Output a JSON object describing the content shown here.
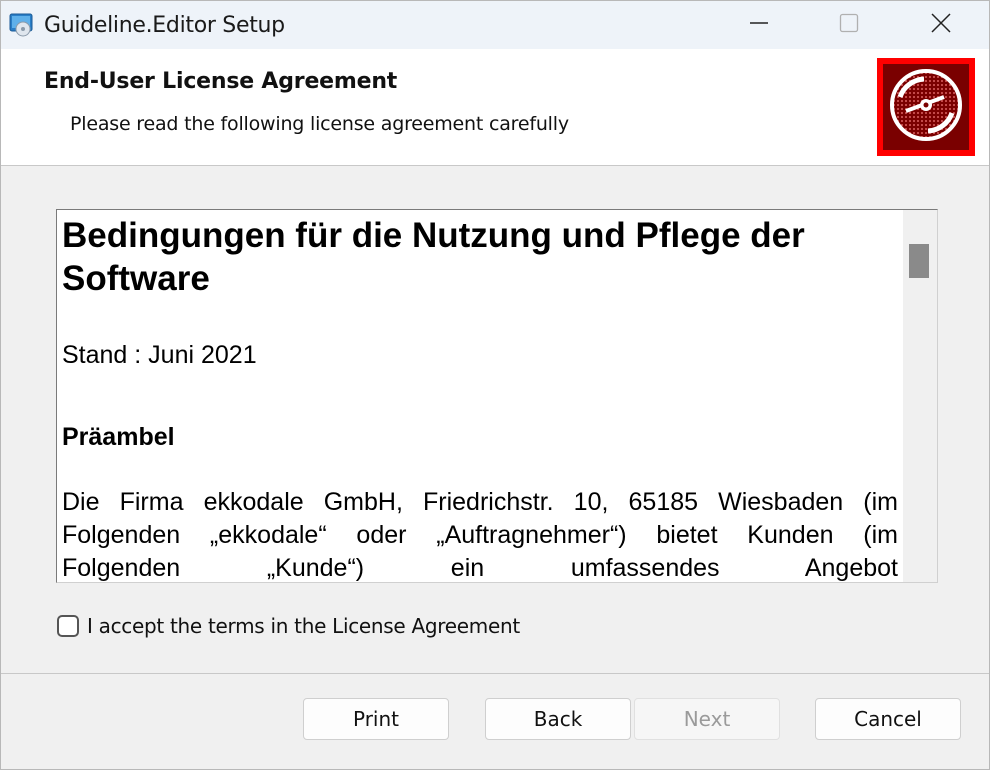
{
  "window": {
    "title": "Guideline.Editor Setup",
    "icons": [
      "installer-app-icon",
      "minimize-icon",
      "maximize-icon",
      "close-icon"
    ]
  },
  "header": {
    "title": "End-User License Agreement",
    "subtitle": "Please read the following license agreement carefully",
    "logo_icon": "disc-logo-icon"
  },
  "license": {
    "heading": "Bedingungen für die Nutzung und Pflege der Software",
    "stand": "Stand : Juni 2021",
    "section_title": "Präambel",
    "paragraph": "Die Firma ekkodale GmbH, Friedrichstr. 10, 65185 Wiesbaden (im Folgenden „ekkodale“ oder „Auftragnehmer“) bietet Kunden (im Folgenden „Kunde“) ein umfassendes Angebot"
  },
  "accept": {
    "label": "I accept the terms in the License Agreement",
    "checked": false
  },
  "buttons": {
    "print": "Print",
    "back": "Back",
    "next": "Next",
    "cancel": "Cancel"
  },
  "colors": {
    "logo_border": "#ff0000",
    "logo_fill": "#7a0000"
  }
}
